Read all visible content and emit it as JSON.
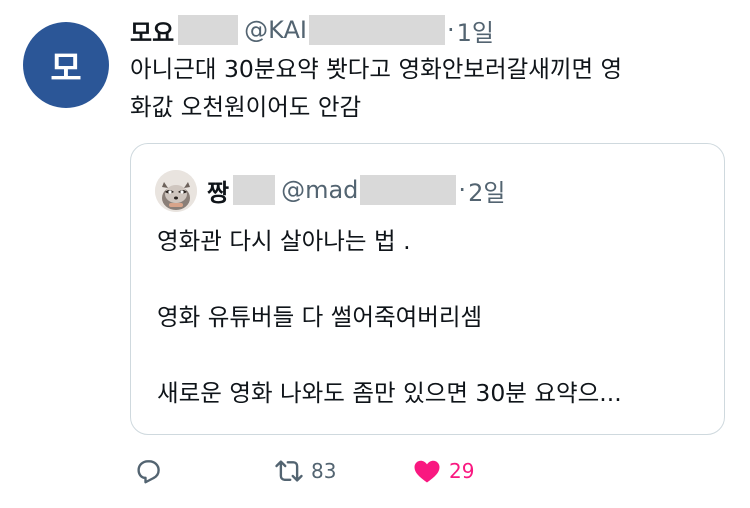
{
  "tweet": {
    "avatar_text": "모",
    "display_name": "모요",
    "handle": "@KAI",
    "dot": "·",
    "time": "1일",
    "text": "아니근대 30분요약 봣다고 영화안보러갈새끼면 영\n화값 오천원이어도 안감"
  },
  "quote": {
    "display_name": "짱",
    "handle": "@mad",
    "dot": "·",
    "time": "2일",
    "lines": [
      "영화관 다시 살아나는 법 .",
      "영화 유튜버들 다 썰어죽여버리셈",
      "새로운 영화 나와도 좀만 있으면 30분 요약으..."
    ]
  },
  "actions": {
    "reply_icon": "reply-icon",
    "retweet_icon": "retweet-icon",
    "retweet_count": "83",
    "like_icon": "heart-icon",
    "like_count": "29"
  },
  "colors": {
    "avatar_bg": "#2b5697",
    "secondary_text": "#536471",
    "like": "#f91880",
    "border": "#cfd9de"
  }
}
